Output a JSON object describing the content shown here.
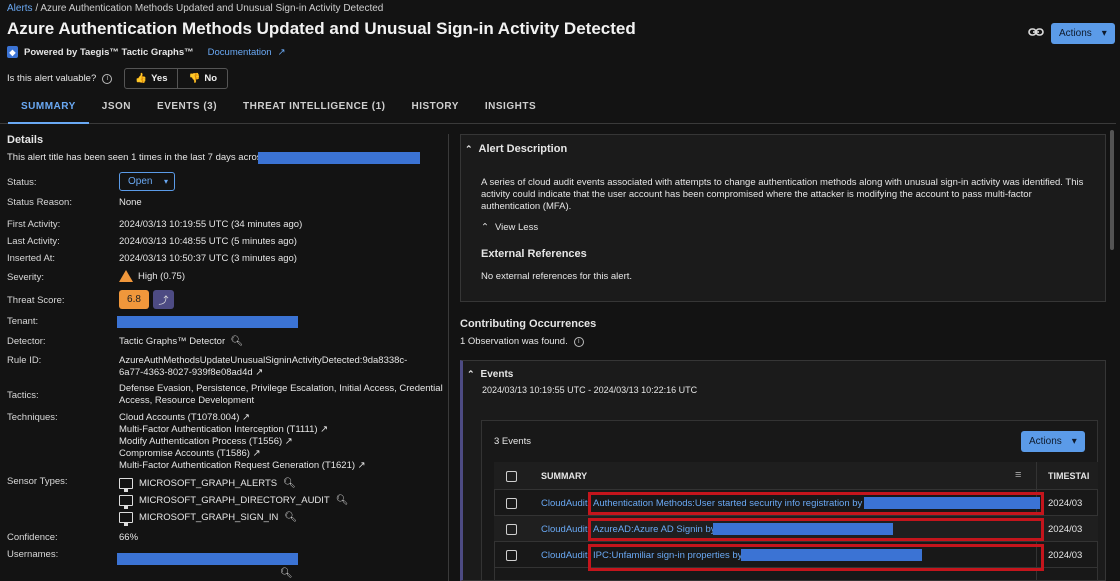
{
  "breadcrumb": {
    "root": "Alerts",
    "sep": "/",
    "current": "Azure Authentication Methods Updated and Unusual Sign-in Activity Detected"
  },
  "title": "Azure Authentication Methods Updated and Unusual Sign-in Activity Detected",
  "powered_by": "Powered by Taegis™ Tactic Graphs™",
  "documentation": "Documentation",
  "valuable": {
    "question": "Is this alert valuable?",
    "yes": "Yes",
    "no": "No"
  },
  "actions_label": "Actions",
  "tabs": [
    "SUMMARY",
    "JSON",
    "EVENTS (3)",
    "THREAT INTELLIGENCE (1)",
    "HISTORY",
    "INSIGHTS"
  ],
  "details": {
    "heading": "Details",
    "seen_text": "This alert title has been seen 1 times in the last 7 days across",
    "status_label": "Status:",
    "status_value": "Open",
    "status_reason_label": "Status Reason:",
    "status_reason_value": "None",
    "first_activity_label": "First Activity:",
    "first_activity_value": "2024/03/13 10:19:55 UTC (34 minutes ago)",
    "last_activity_label": "Last Activity:",
    "last_activity_value": "2024/03/13 10:48:55 UTC (5 minutes ago)",
    "inserted_label": "Inserted At:",
    "inserted_value": "2024/03/13 10:50:37 UTC (3 minutes ago)",
    "severity_label": "Severity:",
    "severity_value": "High (0.75)",
    "threat_score_label": "Threat Score:",
    "threat_score_value": "6.8",
    "tenant_label": "Tenant:",
    "detector_label": "Detector:",
    "detector_value": "Tactic Graphs™ Detector",
    "rule_id_label": "Rule ID:",
    "rule_id_line1": "AzureAuthMethodsUpdateUnusualSigninActivityDetected:9da8338c-",
    "rule_id_line2": "6a77-4363-8027-939f8e08ad4d",
    "tactics_label": "Tactics:",
    "tactics_line1": "Defense Evasion, Persistence, Privilege Escalation, Initial Access, Credential",
    "tactics_line2": "Access, Resource Development",
    "techniques_label": "Techniques:",
    "techniques": [
      "Cloud Accounts (T1078.004)",
      "Multi-Factor Authentication Interception (T1111)",
      "Modify Authentication Process (T1556)",
      "Compromise Accounts (T1586)",
      "Multi-Factor Authentication Request Generation (T1621)"
    ],
    "sensor_types_label": "Sensor Types:",
    "sensor_types": [
      "MICROSOFT_GRAPH_ALERTS",
      "MICROSOFT_GRAPH_DIRECTORY_AUDIT",
      "MICROSOFT_GRAPH_SIGN_IN"
    ],
    "confidence_label": "Confidence:",
    "confidence_value": "66%",
    "usernames_label": "Usernames:"
  },
  "alert_description": {
    "heading": "Alert Description",
    "text": "A series of cloud audit events associated with attempts to change authentication methods along with unusual sign-in activity was identified.  This activity could indicate that the user account has been compromised where the attacker is modifying the account to pass multi-factor authentication (MFA).",
    "view_less": "View Less",
    "ext_ref_heading": "External References",
    "ext_ref_text": "No external references for this alert."
  },
  "contributing": {
    "heading": "Contributing Occurrences",
    "observation": "1 Observation was found.",
    "events_heading": "Events",
    "events_range": "2024/03/13 10:19:55 UTC - 2024/03/13 10:22:16 UTC",
    "events_count": "3 Events",
    "columns": {
      "summary": "SUMMARY",
      "timestamp": "TIMESTAI"
    },
    "rows": [
      {
        "source": "CloudAudit",
        "summary": "Authentication Methods:User started security info registration by",
        "timestamp": "2024/03"
      },
      {
        "source": "CloudAudit",
        "summary": "AzureAD:Azure AD Signin by",
        "timestamp": "2024/03"
      },
      {
        "source": "CloudAudit",
        "summary": "IPC:Unfamiliar sign-in properties by",
        "timestamp": "2024/03"
      }
    ]
  },
  "colors": {
    "accent": "#6aa9f4",
    "severity": "#f0973b",
    "redaction": "#3b73d4",
    "highlight": "#c4151c"
  }
}
